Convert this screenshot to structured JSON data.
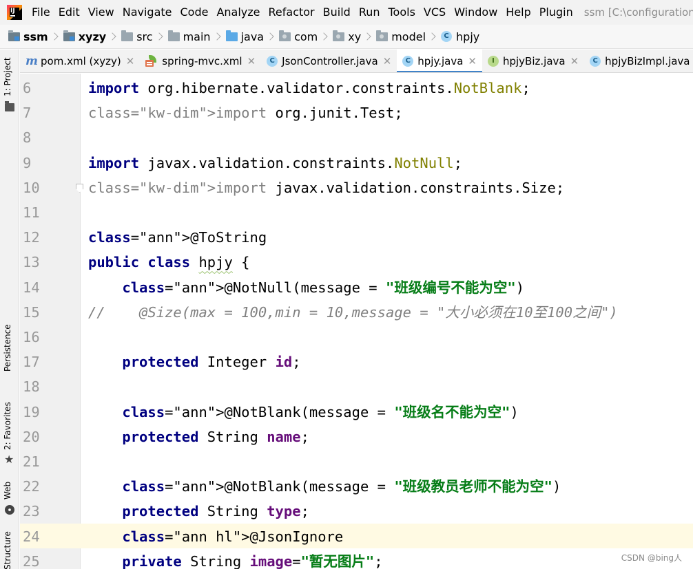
{
  "menubar": {
    "logo_text": "IJ",
    "items": [
      "File",
      "Edit",
      "View",
      "Navigate",
      "Code",
      "Analyze",
      "Refactor",
      "Build",
      "Run",
      "Tools",
      "VCS",
      "Window",
      "Help",
      "Plugin"
    ],
    "window_title": "ssm [C:\\configuration"
  },
  "breadcrumb": [
    "ssm",
    "xyzy",
    "src",
    "main",
    "java",
    "com",
    "xy",
    "model",
    "hpjy"
  ],
  "left_tools": {
    "project": "1: Project",
    "persistence": "Persistence",
    "favorites": "2: Favorites",
    "web": "Web",
    "structure": "Structure"
  },
  "tabs": [
    {
      "label": "pom.xml (xyzy)",
      "icon": "maven-icon",
      "active": false
    },
    {
      "label": "spring-mvc.xml",
      "icon": "spring-xml-icon",
      "active": false
    },
    {
      "label": "JsonController.java",
      "icon": "class-icon",
      "active": false
    },
    {
      "label": "hpjy.java",
      "icon": "class-icon",
      "active": true
    },
    {
      "label": "hpjyBiz.java",
      "icon": "interface-icon",
      "active": false
    },
    {
      "label": "hpjyBizImpl.java",
      "icon": "class-icon",
      "active": false
    }
  ],
  "editor": {
    "caret_line": 24,
    "lines": [
      {
        "n": "6",
        "code": "import org.hibernate.validator.constraints.NotBlank;"
      },
      {
        "n": "7",
        "code": "import org.junit.Test;"
      },
      {
        "n": "8",
        "code": ""
      },
      {
        "n": "9",
        "code": "import javax.validation.constraints.NotNull;"
      },
      {
        "n": "10",
        "code": "import javax.validation.constraints.Size;"
      },
      {
        "n": "11",
        "code": ""
      },
      {
        "n": "12",
        "code": "@ToString"
      },
      {
        "n": "13",
        "code": "public class hpjy {"
      },
      {
        "n": "14",
        "code": "    @NotNull(message = \"班级编号不能为空\")"
      },
      {
        "n": "15",
        "code": "//    @Size(max = 100,min = 10,message = \"大小必须在10至100之间\")"
      },
      {
        "n": "16",
        "code": ""
      },
      {
        "n": "17",
        "code": "    protected Integer id;"
      },
      {
        "n": "18",
        "code": ""
      },
      {
        "n": "19",
        "code": "    @NotBlank(message = \"班级名不能为空\")"
      },
      {
        "n": "20",
        "code": "    protected String name;"
      },
      {
        "n": "21",
        "code": ""
      },
      {
        "n": "22",
        "code": "    @NotBlank(message = \"班级教员老师不能为空\")"
      },
      {
        "n": "23",
        "code": "    protected String type;"
      },
      {
        "n": "24",
        "code": "    @JsonIgnore"
      },
      {
        "n": "25",
        "code": "    private String image=\"暂无图片\";"
      }
    ]
  },
  "watermark": "CSDN @bing人",
  "colors": {
    "keyword": "#000080",
    "annotation": "#808000",
    "string": "#067d17",
    "field": "#660e7a",
    "comment": "#808080",
    "caret_row": "#fffae3",
    "tab_underline": "#4083c9"
  }
}
